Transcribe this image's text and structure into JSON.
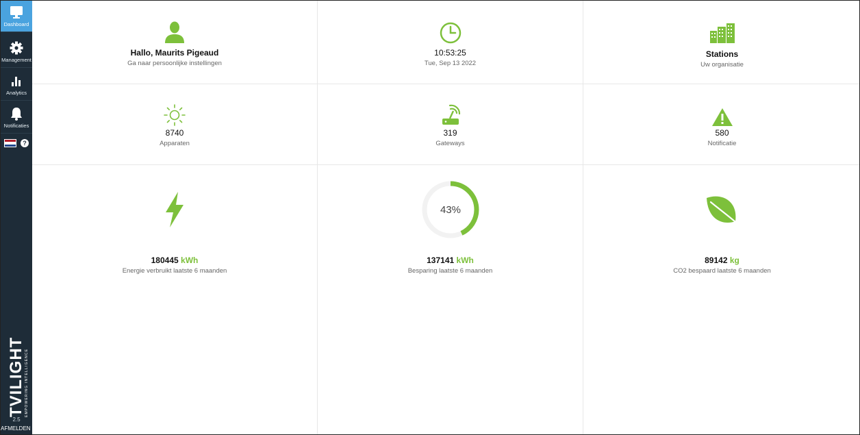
{
  "sidebar": {
    "items": [
      {
        "label": "Dashboard",
        "icon": "monitor-icon",
        "active": true
      },
      {
        "label": "Management",
        "icon": "gear-icon",
        "active": false
      },
      {
        "label": "Analytics",
        "icon": "bar-chart-icon",
        "active": false
      },
      {
        "label": "Notificaties",
        "icon": "bell-icon",
        "active": false
      }
    ],
    "help_glyph": "?",
    "brand": {
      "name": "TVILIGHT",
      "tagline": "EMPOWERING INTELLIGENCE"
    },
    "version": "2.5",
    "logout_label": "AFMELDEN"
  },
  "tiles": {
    "user": {
      "title": "Hallo, Maurits Pigeaud",
      "subtitle": "Ga naar persoonlijke instellingen"
    },
    "clock": {
      "time": "10:53:25",
      "date": "Tue, Sep 13 2022"
    },
    "stations": {
      "title": "Stations",
      "subtitle": "Uw organisatie"
    },
    "devices": {
      "value": "8740",
      "label": "Apparaten"
    },
    "gateways": {
      "value": "319",
      "label": "Gateways"
    },
    "notifications": {
      "value": "580",
      "label": "Notificatie"
    },
    "energy": {
      "value": "180445",
      "unit": "kWh",
      "label": "Energie verbruikt laatste 6 maanden"
    },
    "savings": {
      "percent_label": "43%",
      "percent": 43,
      "value": "137141",
      "unit": "kWh",
      "label": "Besparing laatste 6 maanden"
    },
    "co2": {
      "value": "89142",
      "unit": "kg",
      "label": "CO2 bespaard laatste 6 maanden"
    }
  },
  "colors": {
    "accent": "#7dc03b",
    "sidebar": "#1e2c38",
    "active": "#4aa3df"
  }
}
